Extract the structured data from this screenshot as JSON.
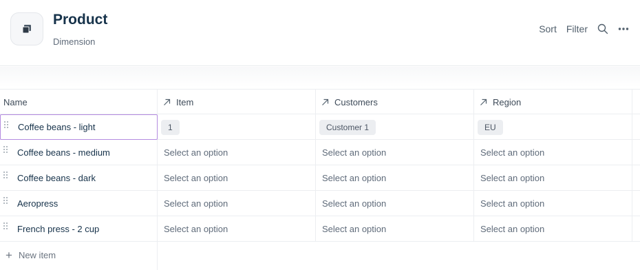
{
  "page": {
    "title": "Product",
    "subtitle": "Dimension",
    "icon": "cube-icon"
  },
  "toolbar": {
    "sort_label": "Sort",
    "filter_label": "Filter",
    "search_icon": "search-icon",
    "more_icon": "more-horizontal-icon"
  },
  "table": {
    "columns": [
      {
        "label": "Name",
        "icon": null
      },
      {
        "label": "Item",
        "icon": "arrow-up-right-icon"
      },
      {
        "label": "Customers",
        "icon": "arrow-up-right-icon"
      },
      {
        "label": "Region",
        "icon": "arrow-up-right-icon"
      }
    ],
    "rows": [
      {
        "name": "Coffee beans - light",
        "item": "1",
        "customers": "Customer 1",
        "region": "EU"
      },
      {
        "name": "Coffee beans - medium",
        "item": "Select an option",
        "customers": "Select an option",
        "region": "Select an option"
      },
      {
        "name": "Coffee beans - dark",
        "item": "Select an option",
        "customers": "Select an option",
        "region": "Select an option"
      },
      {
        "name": "Aeropress",
        "item": "Select an option",
        "customers": "Select an option",
        "region": "Select an option"
      },
      {
        "name": "French press - 2 cup",
        "item": "Select an option",
        "customers": "Select an option",
        "region": "Select an option"
      }
    ]
  },
  "footer": {
    "new_item_label": "New item"
  },
  "colors": {
    "title": "#16324a",
    "selected_border": "#b48be0",
    "chip_bg": "#eceef1"
  }
}
